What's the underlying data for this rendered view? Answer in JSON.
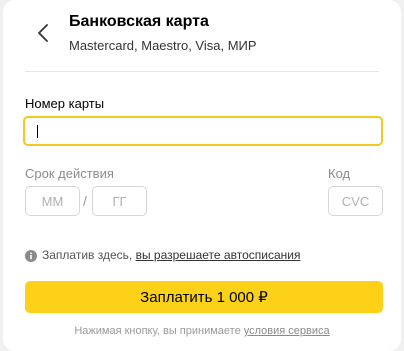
{
  "header": {
    "title": "Банковская карта",
    "subtitle": "Mastercard, Maestro, Visa, МИР",
    "back_icon": "chevron-left-icon"
  },
  "form": {
    "card_number_label": "Номер карты",
    "card_number_value": "",
    "expiry_label": "Срок действия",
    "month_placeholder": "ММ",
    "year_placeholder": "ГГ",
    "separator": "/",
    "cvc_label": "Код",
    "cvc_placeholder": "CVC"
  },
  "info": {
    "icon": "info-icon",
    "text": "Заплатив здесь, ",
    "link": "вы разрешаете автосписания"
  },
  "pay_button": {
    "label": "Заплатить 1 000 ₽"
  },
  "terms": {
    "text": "Нажимая кнопку, вы принимаете ",
    "link": "условия сервиса"
  },
  "colors": {
    "accent": "#fcd117",
    "focus_border": "#f3c820",
    "background": "#f0f0f0"
  }
}
